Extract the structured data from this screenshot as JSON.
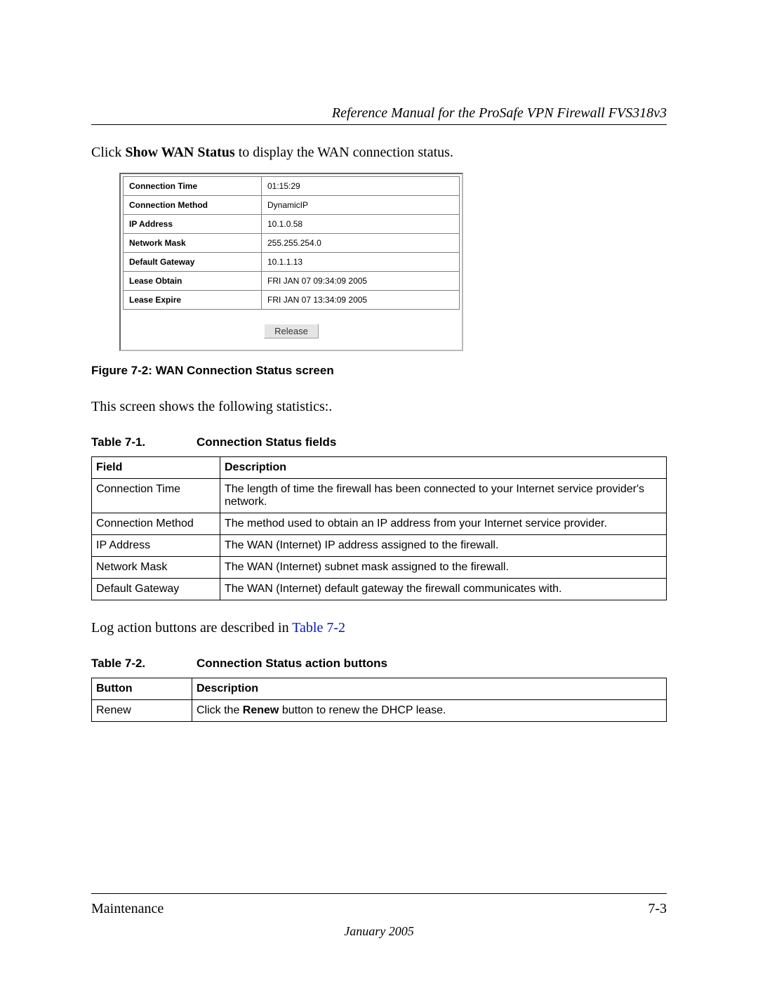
{
  "header": {
    "title": "Reference Manual for the ProSafe VPN Firewall FVS318v3"
  },
  "intro": {
    "prefix": "Click ",
    "bold": "Show WAN Status",
    "suffix": " to display the WAN connection status."
  },
  "wan_status": {
    "rows": [
      {
        "label": "Connection Time",
        "value": "01:15:29"
      },
      {
        "label": "Connection Method",
        "value": "DynamicIP"
      },
      {
        "label": "IP Address",
        "value": "10.1.0.58"
      },
      {
        "label": "Network Mask",
        "value": "255.255.254.0"
      },
      {
        "label": "Default Gateway",
        "value": "10.1.1.13"
      },
      {
        "label": "Lease Obtain",
        "value": "FRI JAN 07 09:34:09 2005"
      },
      {
        "label": "Lease Expire",
        "value": "FRI JAN 07 13:34:09 2005"
      }
    ],
    "button": "Release"
  },
  "figure_caption": "Figure 7-2:  WAN Connection Status screen",
  "stats_text": "This screen shows the following statistics:.",
  "table1": {
    "number": "Table 7-1.",
    "title": "Connection Status fields",
    "head": {
      "c1": "Field",
      "c2": "Description"
    },
    "rows": [
      {
        "c1": "Connection Time",
        "c2": "The length of time the firewall has been connected to your Internet service provider's network."
      },
      {
        "c1": "Connection Method",
        "c2": "The method used to obtain an IP address from your Internet service provider."
      },
      {
        "c1": "IP Address",
        "c2": "The WAN (Internet) IP address assigned to the firewall."
      },
      {
        "c1": "Network Mask",
        "c2": "The WAN (Internet) subnet mask assigned to the firewall."
      },
      {
        "c1": "Default Gateway",
        "c2": "The WAN (Internet) default gateway the firewall communicates with."
      }
    ]
  },
  "log_text": {
    "prefix": "Log action buttons are described in ",
    "link": "Table 7-2"
  },
  "table2": {
    "number": "Table 7-2.",
    "title": "Connection Status action buttons",
    "head": {
      "c1": "Button",
      "c2": "Description"
    },
    "rows": [
      {
        "c1": "Renew",
        "c2_pre": "Click the ",
        "c2_bold": "Renew",
        "c2_post": " button to renew the DHCP lease."
      }
    ]
  },
  "footer": {
    "left": "Maintenance",
    "right": "7-3",
    "date": "January 2005"
  }
}
